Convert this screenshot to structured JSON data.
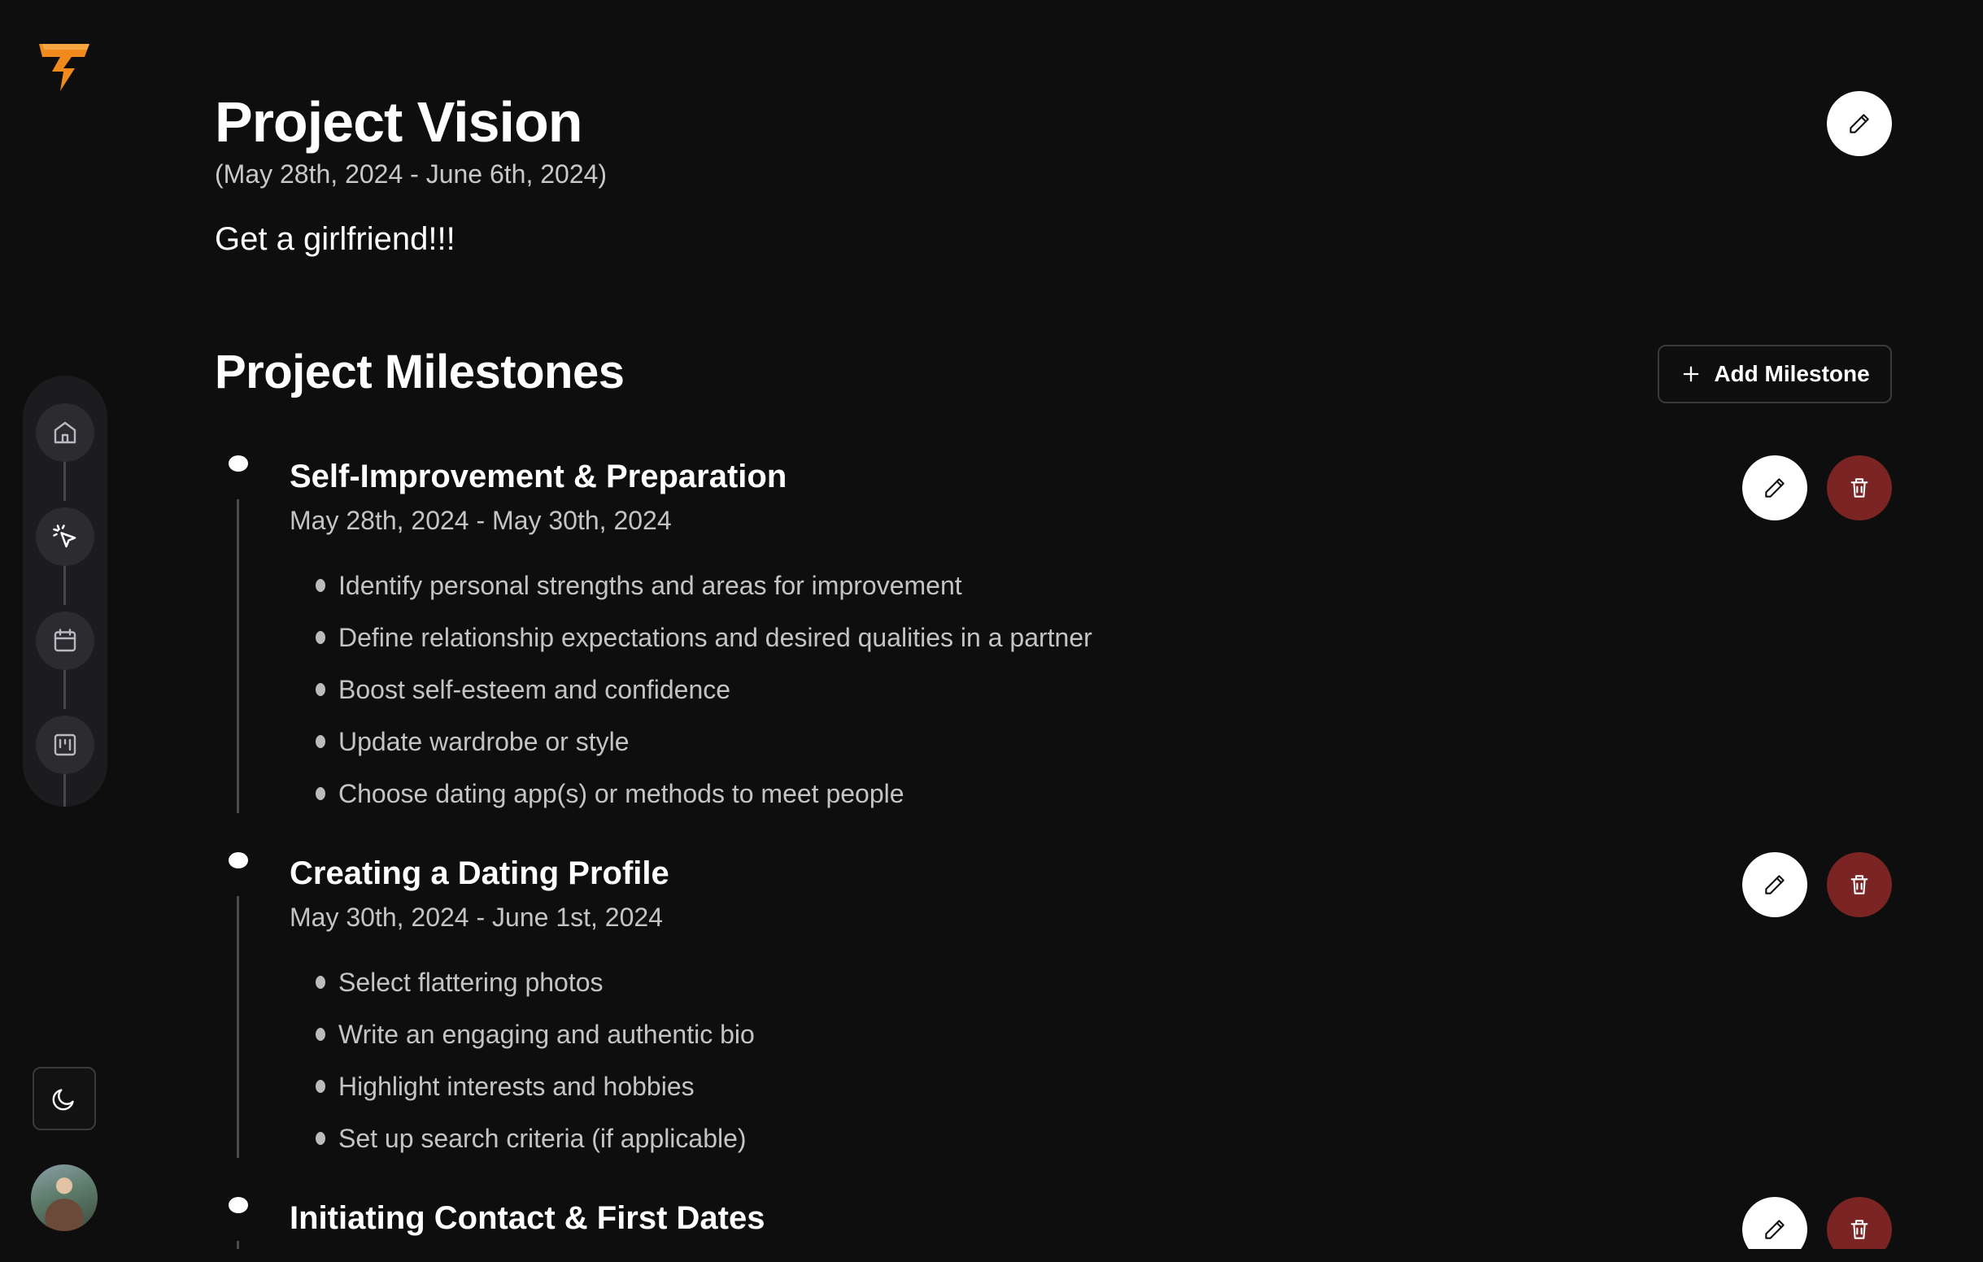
{
  "app": {
    "logo_icon": "lightning-logo",
    "accent_color": "#f08a1c",
    "danger_color": "#7a2424"
  },
  "sidebar": {
    "items": [
      {
        "name": "home",
        "icon": "home-icon"
      },
      {
        "name": "vision",
        "icon": "cursor-click-icon"
      },
      {
        "name": "calendar",
        "icon": "calendar-icon"
      },
      {
        "name": "board",
        "icon": "board-icon"
      }
    ],
    "theme_toggle_icon": "moon-icon",
    "avatar_icon": "user-avatar"
  },
  "vision": {
    "title": "Project Vision",
    "date_range": "(May 28th, 2024 - June 6th, 2024)",
    "goal": "Get a girlfriend!!!",
    "edit_icon": "pencil-icon"
  },
  "milestones": {
    "heading": "Project Milestones",
    "add_label": "Add Milestone",
    "add_icon": "plus-icon",
    "items": [
      {
        "title": "Self-Improvement & Preparation",
        "dates": "May 28th, 2024 - May 30th, 2024",
        "tasks": [
          "Identify personal strengths and areas for improvement",
          "Define relationship expectations and desired qualities in a partner",
          "Boost self-esteem and confidence",
          "Update wardrobe or style",
          "Choose dating app(s) or methods to meet people"
        ]
      },
      {
        "title": "Creating a Dating Profile",
        "dates": "May 30th, 2024 - June 1st, 2024",
        "tasks": [
          "Select flattering photos",
          "Write an engaging and authentic bio",
          "Highlight interests and hobbies",
          "Set up search criteria (if applicable)"
        ]
      },
      {
        "title": "Initiating Contact & First Dates",
        "dates": "",
        "tasks": []
      }
    ]
  }
}
